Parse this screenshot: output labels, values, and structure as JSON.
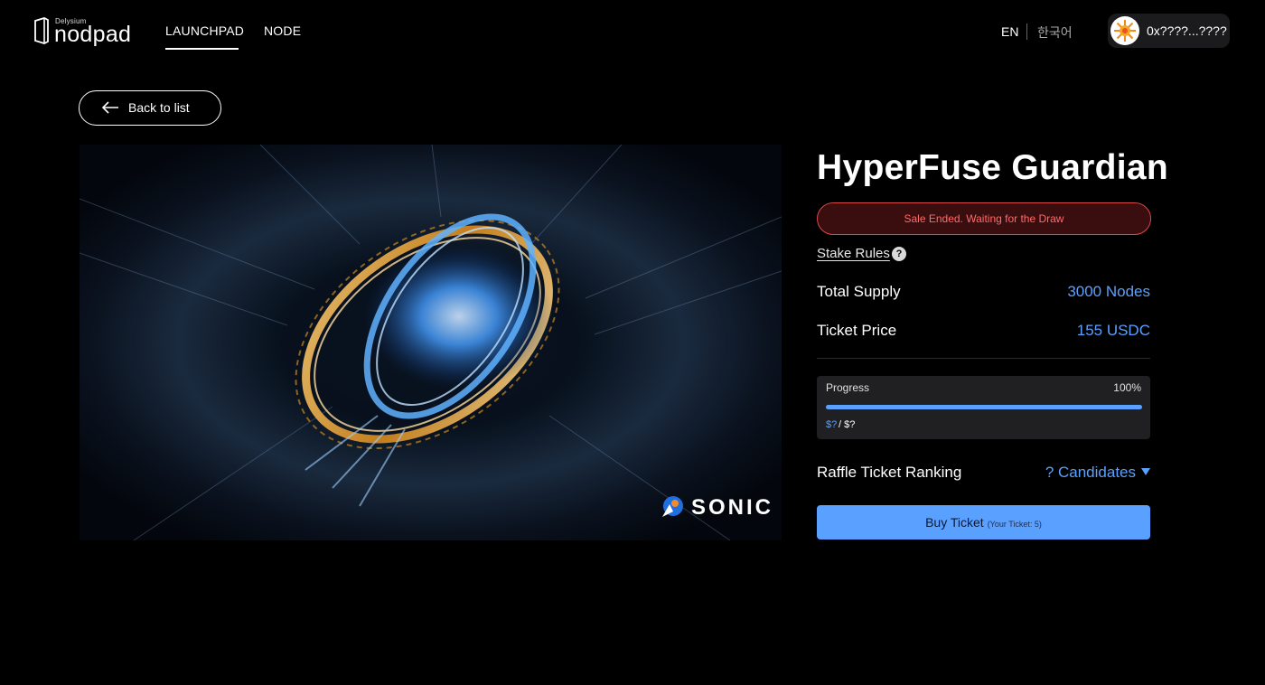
{
  "header": {
    "logo_small": "Delysium",
    "logo_big": "nodpad",
    "nav": [
      {
        "label": "LAUNCHPAD",
        "active": true
      },
      {
        "label": "NODE",
        "active": false
      }
    ],
    "lang_en": "EN",
    "lang_ko": "한국어",
    "wallet_address": "0x????...????"
  },
  "back": {
    "label": "Back to list"
  },
  "hero": {
    "brand": "SONIC"
  },
  "detail": {
    "title": "HyperFuse Guardian",
    "status": "Sale Ended. Waiting for the Draw",
    "stake_rules": "Stake Rules",
    "help": "?",
    "total_supply_label": "Total Supply",
    "total_supply_value": "3000 Nodes",
    "ticket_price_label": "Ticket Price",
    "ticket_price_value": "155 USDC",
    "progress_label": "Progress",
    "progress_percent": "100%",
    "progress_fraction": 1.0,
    "progress_amount_raised": "$?",
    "progress_amount_total": "/ $?",
    "raffle_label": "Raffle Ticket Ranking",
    "candidates": "? Candidates",
    "buy_label": "Buy Ticket",
    "buy_sub": "(Your Ticket: 5)"
  },
  "colors": {
    "accent": "#5aa0ff",
    "status_red": "#ff6a6a",
    "background": "#000000"
  }
}
